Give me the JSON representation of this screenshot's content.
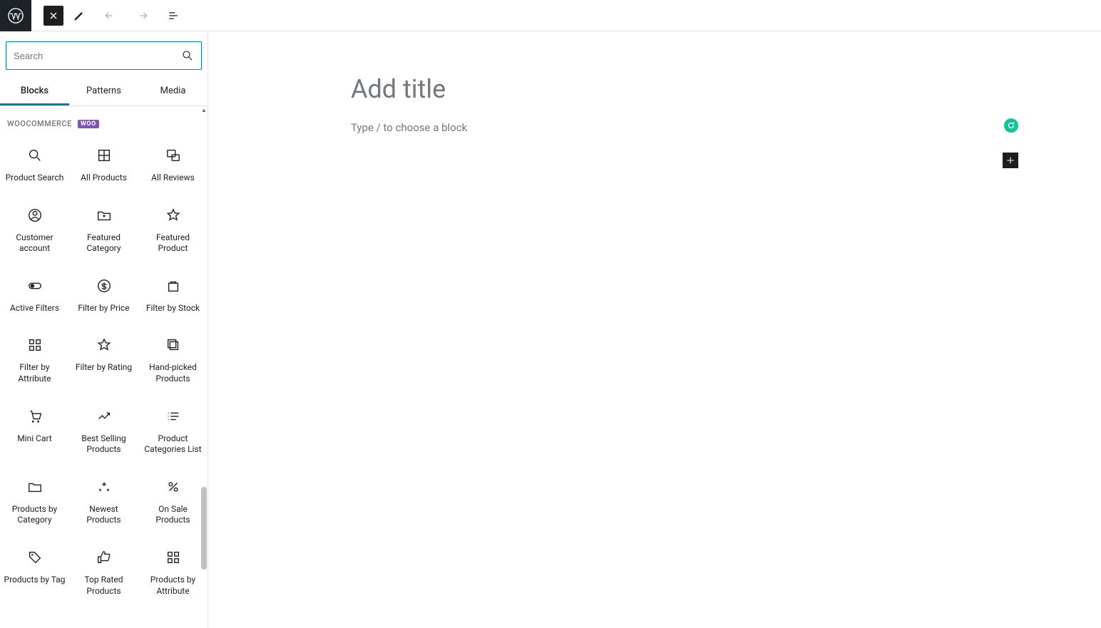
{
  "toolbar": {
    "undo_disabled": true,
    "redo_disabled": true
  },
  "sidebar": {
    "search_placeholder": "Search",
    "tabs": [
      "Blocks",
      "Patterns",
      "Media"
    ],
    "active_tab": 0,
    "section": {
      "title": "WOOCOMMERCE",
      "badge": "WOO"
    },
    "blocks": [
      {
        "label": "Product Search",
        "icon": "search"
      },
      {
        "label": "All Products",
        "icon": "grid"
      },
      {
        "label": "All Reviews",
        "icon": "reviews"
      },
      {
        "label": "Customer account",
        "icon": "account"
      },
      {
        "label": "Featured Category",
        "icon": "folder-plus"
      },
      {
        "label": "Featured Product",
        "icon": "star"
      },
      {
        "label": "Active Filters",
        "icon": "toggle"
      },
      {
        "label": "Filter by Price",
        "icon": "dollar"
      },
      {
        "label": "Filter by Stock",
        "icon": "box"
      },
      {
        "label": "Filter by Attribute",
        "icon": "grid4"
      },
      {
        "label": "Filter by Rating",
        "icon": "star"
      },
      {
        "label": "Hand-picked Products",
        "icon": "stack"
      },
      {
        "label": "Mini Cart",
        "icon": "cart"
      },
      {
        "label": "Best Selling Products",
        "icon": "trend"
      },
      {
        "label": "Product Categories List",
        "icon": "list"
      },
      {
        "label": "Products by Category",
        "icon": "folder"
      },
      {
        "label": "Newest Products",
        "icon": "sparkle"
      },
      {
        "label": "On Sale Products",
        "icon": "percent"
      },
      {
        "label": "Products by Tag",
        "icon": "tag"
      },
      {
        "label": "Top Rated Products",
        "icon": "thumbs-up"
      },
      {
        "label": "Products by Attribute",
        "icon": "grid4"
      }
    ]
  },
  "editor": {
    "title_placeholder": "Add title",
    "paragraph_placeholder": "Type / to choose a block"
  }
}
